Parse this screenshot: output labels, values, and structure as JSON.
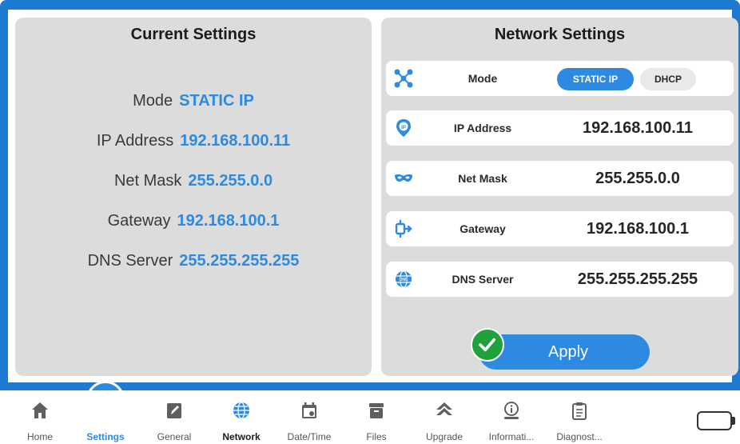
{
  "current": {
    "title": "Current Settings",
    "rows": [
      {
        "label": "Mode",
        "value": "STATIC IP"
      },
      {
        "label": "IP Address",
        "value": "192.168.100.11"
      },
      {
        "label": "Net Mask",
        "value": "255.255.0.0"
      },
      {
        "label": "Gateway",
        "value": "192.168.100.1"
      },
      {
        "label": "DNS Server",
        "value": "255.255.255.255"
      }
    ]
  },
  "network": {
    "title": "Network Settings",
    "mode_label": "Mode",
    "mode_options": [
      "STATIC IP",
      "DHCP"
    ],
    "mode_selected": "STATIC IP",
    "fields": [
      {
        "label": "IP Address",
        "value": "192.168.100.11",
        "icon": "ip-pin-icon"
      },
      {
        "label": "Net Mask",
        "value": "255.255.0.0",
        "icon": "mask-icon"
      },
      {
        "label": "Gateway",
        "value": "192.168.100.1",
        "icon": "gateway-icon"
      },
      {
        "label": "DNS Server",
        "value": "255.255.255.255",
        "icon": "dns-globe-icon"
      }
    ],
    "apply_label": "Apply"
  },
  "tabs": [
    {
      "label": "Home",
      "icon": "home-icon"
    },
    {
      "label": "Settings",
      "icon": "gears-icon"
    },
    {
      "label": "General",
      "icon": "edit-icon"
    },
    {
      "label": "Network",
      "icon": "globe-icon"
    },
    {
      "label": "Date/Time",
      "icon": "calendar-icon"
    },
    {
      "label": "Files",
      "icon": "files-icon"
    },
    {
      "label": "Upgrade",
      "icon": "upgrade-icon"
    },
    {
      "label": "Informati...",
      "icon": "info-icon"
    },
    {
      "label": "Diagnost...",
      "icon": "clipboard-icon"
    }
  ],
  "colors": {
    "accent": "#2e8ae0",
    "frame": "#1e7ad0",
    "panel": "#dcdcdc",
    "success": "#1fa13c"
  }
}
